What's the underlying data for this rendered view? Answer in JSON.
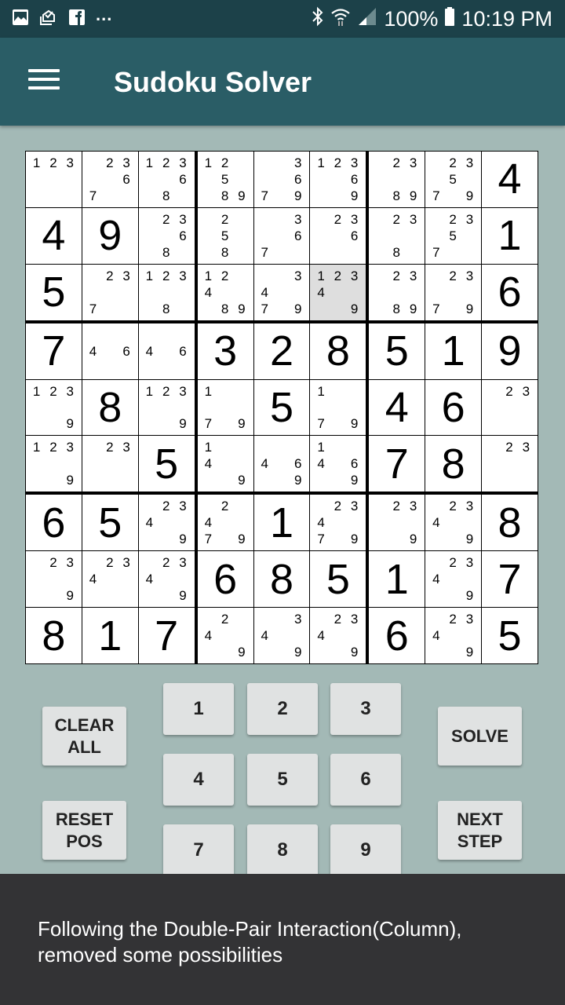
{
  "status_bar": {
    "left_icons": [
      "gallery-icon",
      "mail-icon",
      "facebook-icon"
    ],
    "more": "...",
    "battery": "100%",
    "time": "10:19 PM"
  },
  "app_bar": {
    "title": "Sudoku Solver"
  },
  "board": {
    "selected": [
      2,
      5
    ],
    "cells": [
      [
        {
          "c": [
            1,
            2,
            3
          ]
        },
        {
          "c": [
            2,
            3,
            6,
            7
          ]
        },
        {
          "c": [
            1,
            2,
            3,
            6,
            8
          ]
        },
        {
          "c": [
            1,
            2,
            5,
            8,
            9
          ]
        },
        {
          "c": [
            3,
            6,
            7,
            9
          ]
        },
        {
          "c": [
            1,
            2,
            3,
            6,
            9
          ]
        },
        {
          "c": [
            2,
            3,
            8,
            9
          ]
        },
        {
          "c": [
            2,
            3,
            5,
            7,
            9
          ]
        },
        {
          "v": 4
        }
      ],
      [
        {
          "v": 4
        },
        {
          "v": 9
        },
        {
          "c": [
            2,
            3,
            6,
            8
          ]
        },
        {
          "c": [
            2,
            5,
            8
          ]
        },
        {
          "c": [
            3,
            6,
            7
          ]
        },
        {
          "c": [
            2,
            3,
            6
          ]
        },
        {
          "c": [
            2,
            3,
            8
          ]
        },
        {
          "c": [
            2,
            3,
            5,
            7
          ]
        },
        {
          "v": 1
        }
      ],
      [
        {
          "v": 5
        },
        {
          "c": [
            2,
            3,
            7
          ]
        },
        {
          "c": [
            1,
            2,
            3,
            8
          ]
        },
        {
          "c": [
            1,
            2,
            4,
            8,
            9
          ]
        },
        {
          "c": [
            3,
            4,
            7,
            9
          ]
        },
        {
          "c": [
            1,
            2,
            3,
            4,
            9
          ]
        },
        {
          "c": [
            2,
            3,
            8,
            9
          ]
        },
        {
          "c": [
            2,
            3,
            7,
            9
          ]
        },
        {
          "v": 6
        }
      ],
      [
        {
          "v": 7
        },
        {
          "c": [
            4,
            6
          ]
        },
        {
          "c": [
            4,
            6
          ]
        },
        {
          "v": 3
        },
        {
          "v": 2
        },
        {
          "v": 8
        },
        {
          "v": 5
        },
        {
          "v": 1
        },
        {
          "v": 9
        }
      ],
      [
        {
          "c": [
            1,
            2,
            3,
            9
          ]
        },
        {
          "v": 8
        },
        {
          "c": [
            1,
            2,
            3,
            9
          ]
        },
        {
          "c": [
            1,
            7,
            9
          ]
        },
        {
          "v": 5
        },
        {
          "c": [
            1,
            7,
            9
          ]
        },
        {
          "v": 4
        },
        {
          "v": 6
        },
        {
          "c": [
            2,
            3
          ]
        }
      ],
      [
        {
          "c": [
            1,
            2,
            3,
            9
          ]
        },
        {
          "c": [
            2,
            3
          ]
        },
        {
          "v": 5
        },
        {
          "c": [
            1,
            4,
            9
          ]
        },
        {
          "c": [
            4,
            6,
            9
          ]
        },
        {
          "c": [
            1,
            4,
            6,
            9
          ]
        },
        {
          "v": 7
        },
        {
          "v": 8
        },
        {
          "c": [
            2,
            3
          ]
        }
      ],
      [
        {
          "v": 6
        },
        {
          "v": 5
        },
        {
          "c": [
            2,
            3,
            4,
            9
          ]
        },
        {
          "c": [
            2,
            4,
            7,
            9
          ]
        },
        {
          "v": 1
        },
        {
          "c": [
            2,
            3,
            4,
            7,
            9
          ]
        },
        {
          "c": [
            2,
            3,
            9
          ]
        },
        {
          "c": [
            2,
            3,
            4,
            9
          ]
        },
        {
          "v": 8
        }
      ],
      [
        {
          "c": [
            2,
            3,
            9
          ]
        },
        {
          "c": [
            2,
            3,
            4
          ]
        },
        {
          "c": [
            2,
            3,
            4,
            9
          ]
        },
        {
          "v": 6
        },
        {
          "v": 8
        },
        {
          "v": 5
        },
        {
          "v": 1
        },
        {
          "c": [
            2,
            3,
            4,
            9
          ]
        },
        {
          "v": 7
        }
      ],
      [
        {
          "v": 8
        },
        {
          "v": 1
        },
        {
          "v": 7
        },
        {
          "c": [
            2,
            4,
            9
          ]
        },
        {
          "c": [
            3,
            4,
            9
          ]
        },
        {
          "c": [
            2,
            3,
            4,
            9
          ]
        },
        {
          "v": 6
        },
        {
          "c": [
            2,
            3,
            4,
            9
          ]
        },
        {
          "v": 5
        }
      ]
    ]
  },
  "controls": {
    "clear_all": "CLEAR\nALL",
    "reset_pos": "RESET\nPOS",
    "solve": "SOLVE",
    "next_step": "NEXT\nSTEP",
    "numbers": [
      "1",
      "2",
      "3",
      "4",
      "5",
      "6",
      "7",
      "8",
      "9"
    ]
  },
  "snackbar": {
    "message": "Following the Double-Pair Interaction(Column), removed some possibilities"
  }
}
